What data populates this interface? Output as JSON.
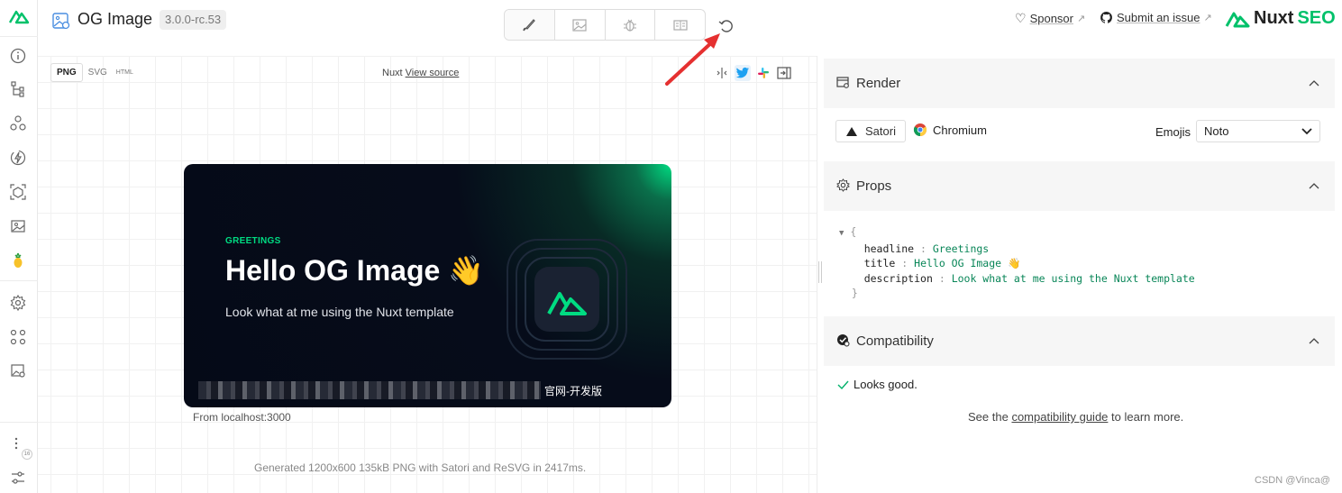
{
  "header": {
    "title": "OG Image",
    "version": "3.0.0-rc.53",
    "sponsor_label": "Sponsor",
    "issue_label": "Submit an issue",
    "brand_name": "Nuxt",
    "brand_suffix": "SEO",
    "brand_color": "#00c16a",
    "tabs": [
      {
        "icon": "brush-icon",
        "active": true
      },
      {
        "icon": "image-icon",
        "active": false
      },
      {
        "icon": "bug-icon",
        "active": false
      },
      {
        "icon": "book-icon",
        "active": false
      }
    ]
  },
  "preview": {
    "formats": [
      "PNG",
      "SVG",
      "HTML"
    ],
    "selected_format": "PNG",
    "source_prefix": "Nuxt",
    "source_link": "View source",
    "og_card": {
      "eyebrow": "GREETINGS",
      "headline": "Hello OG Image 👋",
      "description": "Look what at me using the Nuxt template",
      "footer_visible": "官网-开发版"
    },
    "from": "From localhost:3000",
    "generated": "Generated 1200x600 135kB PNG with Satori and ReSVG in 2417ms."
  },
  "render": {
    "title": "Render",
    "engine_satori": "Satori",
    "engine_chromium": "Chromium",
    "emojis_label": "Emojis",
    "emojis_value": "Noto"
  },
  "props": {
    "title": "Props",
    "open_brace": "{",
    "close_brace": "}",
    "items": [
      {
        "key": "headline",
        "value": "Greetings"
      },
      {
        "key": "title",
        "value": "Hello OG Image 👋"
      },
      {
        "key": "description",
        "value": "Look what at me using the Nuxt template"
      }
    ]
  },
  "compat": {
    "title": "Compatibility",
    "status": "Looks good.",
    "see_prefix": "See the",
    "guide_link": "compatibility guide",
    "see_suffix": "to learn more."
  },
  "sidebar": {
    "badge": "16"
  },
  "watermark": "CSDN @Vinca@"
}
